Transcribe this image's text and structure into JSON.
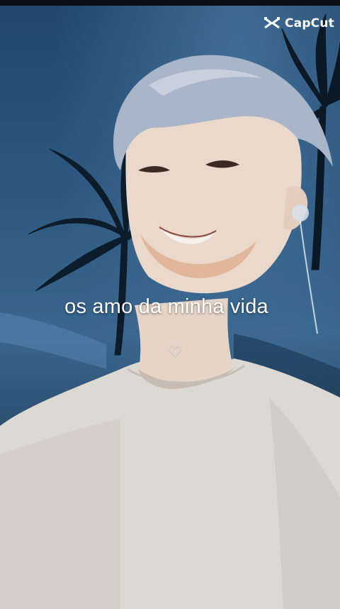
{
  "video": {
    "caption": "os amo da minha vida",
    "heart_symbol": "♡",
    "scene": "person-with-palm-trees-night-sky"
  },
  "watermark": {
    "brand": "CapCut",
    "icon": "capcut-logo-icon"
  },
  "colors": {
    "sky": "#2f5a82",
    "shirt": "#dcd8d2",
    "text": "#ffffff"
  }
}
